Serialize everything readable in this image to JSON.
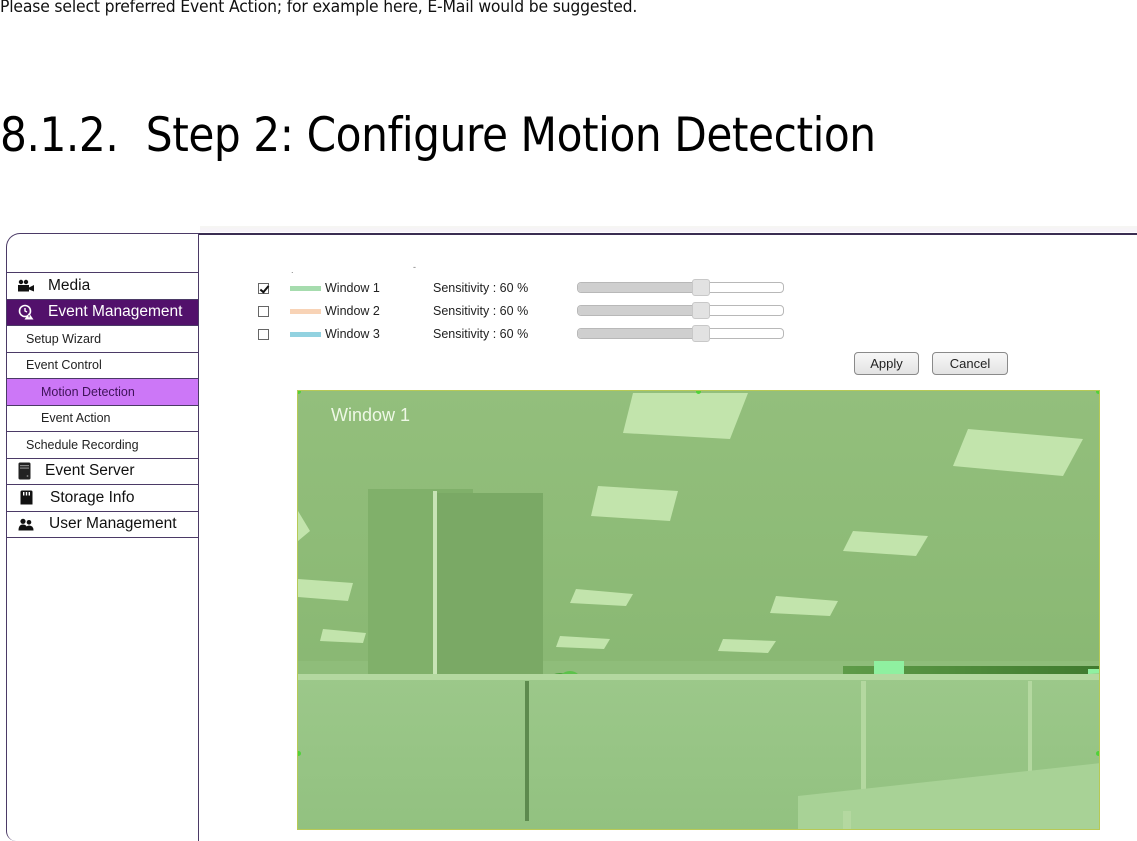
{
  "document": {
    "intro_text": "Please select preferred Event Action; for example here, E-Mail would be suggested.",
    "section_number": "8.1.2.",
    "section_title": "Step 2: Configure Motion Detection"
  },
  "sidebar": {
    "items": [
      {
        "label": "Media",
        "icon": "video-camera-icon",
        "level": "main",
        "state": "normal"
      },
      {
        "label": "Event Management",
        "icon": "event-alarm-icon",
        "level": "main",
        "state": "active"
      },
      {
        "label": "Setup Wizard",
        "level": "sub",
        "state": "normal"
      },
      {
        "label": "Event Control",
        "level": "sub",
        "state": "normal"
      },
      {
        "label": "Motion Detection",
        "level": "sub2",
        "state": "selected"
      },
      {
        "label": "Event Action",
        "level": "sub2",
        "state": "normal"
      },
      {
        "label": "Schedule Recording",
        "level": "sub",
        "state": "normal"
      },
      {
        "label": "Event Server",
        "icon": "server-icon",
        "level": "main",
        "state": "normal"
      },
      {
        "label": "Storage Info",
        "icon": "sd-card-icon",
        "level": "main",
        "state": "normal"
      },
      {
        "label": "User Management",
        "icon": "users-icon",
        "level": "main",
        "state": "normal"
      }
    ]
  },
  "motion": {
    "windows": [
      {
        "label": "Window 1",
        "checked": true,
        "color": "#a6dcae",
        "sensitivity_label": "Sensitivity : 60 %",
        "sensitivity": 60
      },
      {
        "label": "Window 2",
        "checked": false,
        "color": "#f8d3b6",
        "sensitivity_label": "Sensitivity : 60 %",
        "sensitivity": 60
      },
      {
        "label": "Window 3",
        "checked": false,
        "color": "#92d2e0",
        "sensitivity_label": "Sensitivity : 60 %",
        "sensitivity": 60
      }
    ],
    "apply_label": "Apply",
    "cancel_label": "Cancel",
    "view_overlay_label": "Window 1"
  },
  "colors": {
    "sidebar_active": "#52116b",
    "sidebar_selected": "#cc77f7",
    "border": "#4b3a66",
    "overlay_tint": "#8dbb75"
  }
}
